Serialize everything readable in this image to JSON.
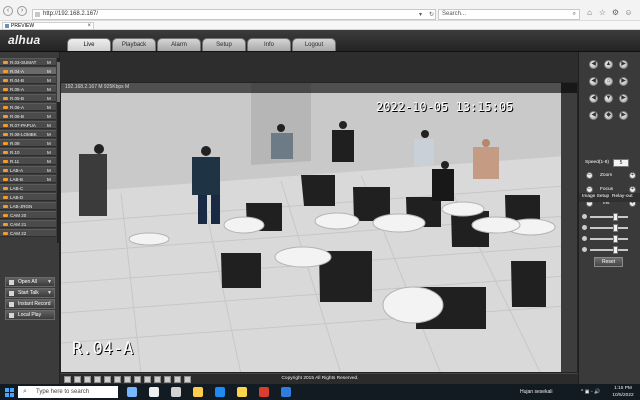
{
  "browser": {
    "url": "http://192.168.2.167/",
    "tab_title": "PREVIEW",
    "search_placeholder": "Search..."
  },
  "app": {
    "brand": "alhua",
    "tabs": [
      "Live",
      "Playback",
      "Alarm",
      "Setup",
      "Info",
      "Logout"
    ],
    "active_tab": "Live",
    "footer": "Copyright 2015 All Rights Reserved."
  },
  "channels": [
    {
      "label": "R.03-SUMAT",
      "flag": "M"
    },
    {
      "label": "R.04-A",
      "flag": "M"
    },
    {
      "label": "R.04-B",
      "flag": "M"
    },
    {
      "label": "R.05-A",
      "flag": "M"
    },
    {
      "label": "R.05-B",
      "flag": "M"
    },
    {
      "label": "R.06-A",
      "flag": "M"
    },
    {
      "label": "R.06-B",
      "flag": "M"
    },
    {
      "label": "R.07-PAPUA",
      "flag": "M"
    },
    {
      "label": "R.08-LOMBK",
      "flag": "M"
    },
    {
      "label": "R.09",
      "flag": "M"
    },
    {
      "label": "R.10",
      "flag": "M"
    },
    {
      "label": "R.11",
      "flag": "M"
    },
    {
      "label": "LAB-A",
      "flag": "M"
    },
    {
      "label": "LAB-B",
      "flag": "M"
    },
    {
      "label": "LAB-C",
      "flag": ""
    },
    {
      "label": "LAB-D",
      "flag": ""
    },
    {
      "label": "LAB-JRGN",
      "flag": ""
    },
    {
      "label": "CAM 20",
      "flag": ""
    },
    {
      "label": "CAM 21",
      "flag": ""
    },
    {
      "label": "CAM 22",
      "flag": ""
    }
  ],
  "left_actions": {
    "open_all": "Open All",
    "start_talk": "Start Talk",
    "instant_record": "Instant Record",
    "local_play": "Local Play"
  },
  "video": {
    "info_text": "192.168.2.167 M 925Kbps M",
    "timestamp": "2022-10-05 13:15:05",
    "camera_label": "R.04-A"
  },
  "ptz": {
    "speed_label": "Speed(1-8)",
    "speed_value": "5",
    "zoom_label": "Zoom",
    "focus_label": "Focus",
    "iris_label": "Iris",
    "image_setup": "Image Setup",
    "relay_out": "Relay-out",
    "reset": "Reset"
  },
  "taskbar": {
    "search_placeholder": "Type here to search",
    "weather": "Hujan sesekali",
    "time": "1:15 PM",
    "date": "10/5/2022"
  },
  "colors": {
    "accent": "#f59b2b",
    "active_tab": "#eeeeee",
    "windows_blue": "#45a6ff"
  }
}
